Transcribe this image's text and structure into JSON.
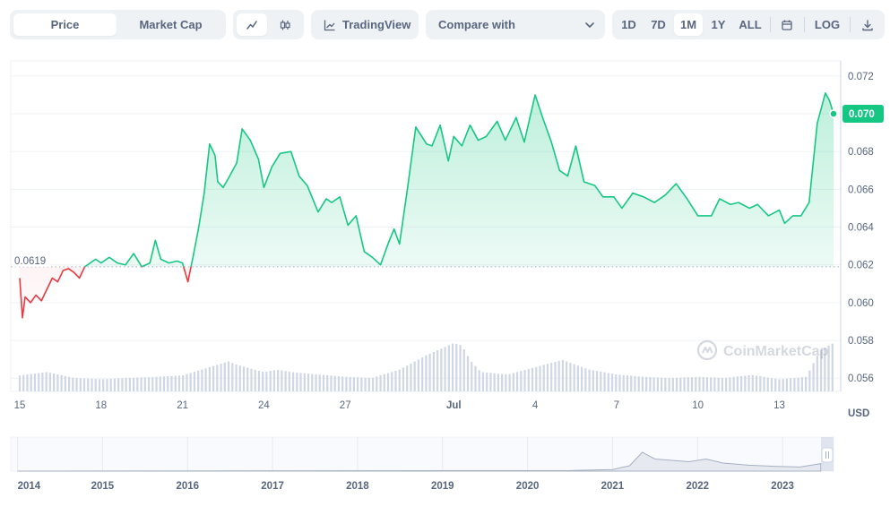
{
  "toolbar": {
    "price_label": "Price",
    "market_cap_label": "Market Cap",
    "tradingview_label": "TradingView",
    "compare_label": "Compare with",
    "ranges": [
      "1D",
      "7D",
      "1M",
      "1Y",
      "ALL"
    ],
    "active_range": "1M",
    "log_label": "LOG",
    "active_view": "Price",
    "active_chart_type": "line",
    "icons": [
      "line-chart-icon",
      "candlestick-icon",
      "tradingview-icon",
      "chevron-down-icon",
      "calendar-icon",
      "download-icon"
    ]
  },
  "colors": {
    "up": "#16c784",
    "down": "#ea3943",
    "volume": "#cfd6e4",
    "grid": "#eff2f5",
    "text": "#58667e"
  },
  "watermark": "CoinMarketCap",
  "chart_data": {
    "type": "line",
    "title": "",
    "xlabel": "",
    "ylabel": "USD",
    "ylim": [
      0.0553,
      0.0728
    ],
    "y_ticks": [
      "0.072",
      "0.070",
      "0.068",
      "0.066",
      "0.064",
      "0.062",
      "0.060",
      "0.058",
      "0.056"
    ],
    "x_ticks": [
      "15",
      "18",
      "21",
      "24",
      "27",
      "Jul",
      "4",
      "7",
      "10",
      "13"
    ],
    "baseline": {
      "value": 0.0619,
      "label": "0.0619"
    },
    "current": {
      "value": 0.07,
      "label": "0.070"
    },
    "series": [
      {
        "day": [
          0,
          0.1,
          0.2,
          0.4,
          0.6,
          0.8,
          1.0,
          1.2,
          1.4,
          1.6,
          1.8,
          2.0,
          2.2,
          2.4,
          2.6,
          2.8,
          3.0,
          3.3,
          3.6,
          3.9,
          4.2,
          4.5,
          4.8,
          5.0,
          5.2,
          5.5,
          5.8,
          6.0,
          6.1,
          6.2,
          6.4,
          6.6,
          6.8,
          7.0,
          7.2,
          7.3,
          7.5,
          7.7,
          8.0,
          8.2,
          8.5,
          8.8,
          9.0,
          9.3,
          9.6,
          10.0,
          10.3,
          10.6,
          11.0,
          11.3,
          11.5,
          11.8,
          12.1,
          12.4,
          12.7,
          13.0,
          13.3,
          13.6,
          13.8,
          14.0,
          14.3,
          14.6,
          15.0,
          15.2,
          15.5,
          15.8,
          16.0,
          16.3,
          16.6,
          16.9,
          17.2,
          17.6,
          17.9,
          18.3,
          18.6,
          19.0,
          19.3,
          19.6,
          19.9,
          20.2,
          20.5,
          20.8,
          21.2,
          21.5,
          21.9,
          22.2,
          22.6,
          23.0,
          23.4,
          23.8,
          24.2,
          24.6,
          25.0,
          25.5,
          25.8,
          26.2,
          26.5,
          26.9,
          27.2,
          27.6,
          28.0,
          28.2,
          28.5,
          28.8,
          29.1,
          29.4,
          29.7,
          29.85,
          30.0
        ],
        "price": [
          0.0613,
          0.0592,
          0.0603,
          0.06,
          0.0604,
          0.0601,
          0.0607,
          0.0613,
          0.0611,
          0.0617,
          0.0618,
          0.0616,
          0.0613,
          0.0619,
          0.0621,
          0.0623,
          0.0621,
          0.0624,
          0.0621,
          0.062,
          0.0626,
          0.0619,
          0.0621,
          0.0633,
          0.0623,
          0.0621,
          0.0622,
          0.0621,
          0.0616,
          0.0611,
          0.0625,
          0.064,
          0.0658,
          0.0684,
          0.0678,
          0.0664,
          0.0661,
          0.0666,
          0.0674,
          0.0692,
          0.0686,
          0.0676,
          0.0661,
          0.0672,
          0.0679,
          0.068,
          0.0667,
          0.0662,
          0.0648,
          0.0655,
          0.0653,
          0.0656,
          0.0641,
          0.0646,
          0.0627,
          0.0624,
          0.062,
          0.0632,
          0.0639,
          0.0631,
          0.0661,
          0.0693,
          0.0684,
          0.0683,
          0.0694,
          0.0675,
          0.0688,
          0.0683,
          0.0694,
          0.0686,
          0.0688,
          0.0696,
          0.0686,
          0.0698,
          0.0685,
          0.071,
          0.0697,
          0.0685,
          0.067,
          0.0667,
          0.0683,
          0.0664,
          0.0662,
          0.0656,
          0.0656,
          0.065,
          0.0658,
          0.0656,
          0.0653,
          0.0657,
          0.0663,
          0.0655,
          0.0646,
          0.0646,
          0.0655,
          0.0652,
          0.0653,
          0.065,
          0.0652,
          0.0646,
          0.0649,
          0.0642,
          0.0646,
          0.0646,
          0.0653,
          0.0695,
          0.0711,
          0.0707,
          0.07
        ]
      }
    ],
    "volume": {
      "day": [
        0,
        1,
        2,
        3,
        4,
        5,
        6,
        7,
        7.7,
        8,
        9,
        9.5,
        10,
        11,
        12,
        13,
        14,
        15,
        16,
        16.3,
        16.6,
        17,
        18,
        19,
        20,
        21,
        22,
        23,
        24,
        25,
        26,
        27,
        28,
        29,
        29.5,
        30
      ],
      "relative_height": [
        0.33,
        0.4,
        0.28,
        0.25,
        0.28,
        0.3,
        0.33,
        0.5,
        0.62,
        0.55,
        0.4,
        0.45,
        0.4,
        0.35,
        0.3,
        0.28,
        0.45,
        0.75,
        1.0,
        0.95,
        0.65,
        0.4,
        0.35,
        0.5,
        0.65,
        0.45,
        0.35,
        0.3,
        0.28,
        0.3,
        0.28,
        0.34,
        0.25,
        0.3,
        0.85,
        1.0
      ]
    },
    "navigator": {
      "x_ticks": [
        "2014",
        "2015",
        "2016",
        "2017",
        "2018",
        "2019",
        "2020",
        "2021",
        "2022",
        "2023"
      ],
      "year": [
        2014.0,
        2020.5,
        2021.0,
        2021.2,
        2021.35,
        2021.5,
        2021.7,
        2021.9,
        2022.1,
        2022.3,
        2022.6,
        2022.9,
        2023.2,
        2023.45
      ],
      "relative_value": [
        0.0,
        0.02,
        0.06,
        0.2,
        0.7,
        0.45,
        0.4,
        0.35,
        0.45,
        0.3,
        0.22,
        0.18,
        0.15,
        0.28
      ]
    }
  }
}
